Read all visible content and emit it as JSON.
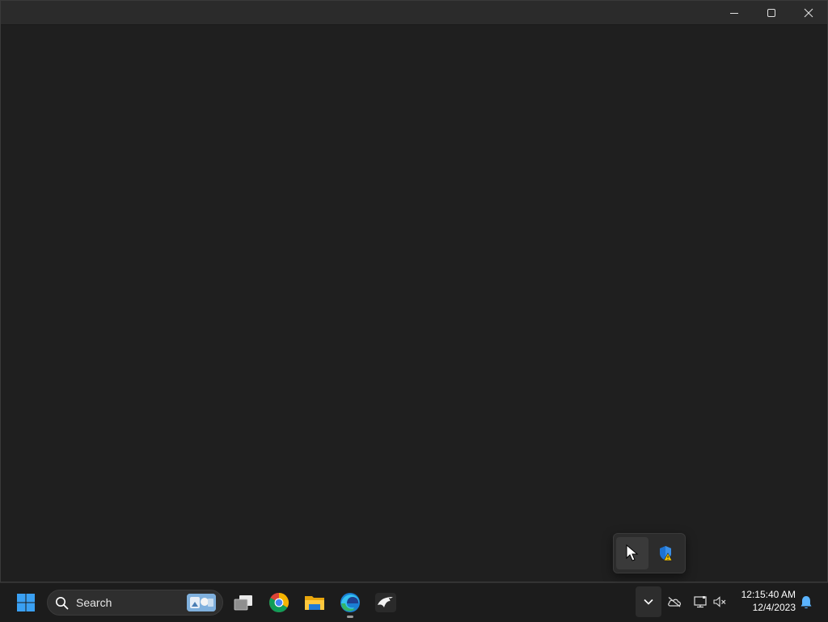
{
  "window": {
    "title": "",
    "caption_buttons": [
      {
        "name": "minimize",
        "icon": "minimize-icon"
      },
      {
        "name": "maximize",
        "icon": "maximize-icon"
      },
      {
        "name": "close",
        "icon": "close-icon"
      }
    ]
  },
  "tray_flyout": {
    "items": [
      {
        "icon": "pointer-icon",
        "selected": true
      },
      {
        "icon": "windows-security-warning-icon",
        "selected": false
      }
    ]
  },
  "taskbar": {
    "start_icon": "windows-start-icon",
    "search": {
      "placeholder": "Search"
    },
    "apps": [
      {
        "name": "Task View",
        "icon": "task-view-icon",
        "running": false
      },
      {
        "name": "Google Chrome",
        "icon": "chrome-icon",
        "running": false
      },
      {
        "name": "File Explorer",
        "icon": "file-explorer-icon",
        "running": false
      },
      {
        "name": "Microsoft Edge",
        "icon": "edge-icon",
        "running": true
      },
      {
        "name": "Eagle App",
        "icon": "eagle-icon",
        "running": false
      }
    ],
    "tray": {
      "overflow_icon": "chevron-up-icon",
      "system_icons": [
        "onedrive-offline-icon",
        "network-icon",
        "volume-muted-icon"
      ],
      "time": "12:15:40 AM",
      "date": "12/4/2023",
      "notification_icon": "bell-icon"
    }
  },
  "colors": {
    "desktop_bg": "#1f1f1f",
    "taskbar_bg": "#1c1c1c",
    "accent_blue": "#0078d4"
  }
}
